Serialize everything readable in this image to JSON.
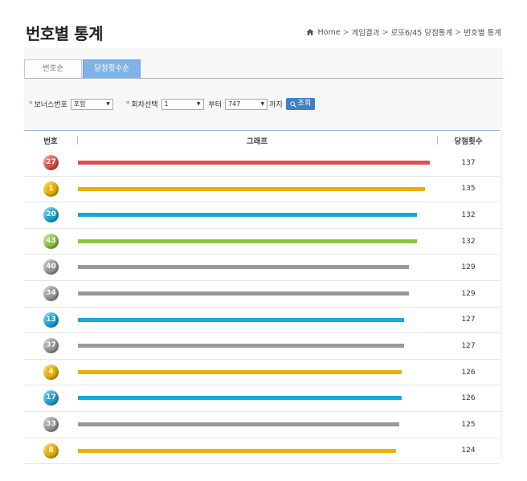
{
  "page": {
    "title": "번호별 통계",
    "breadcrumb": [
      "Home",
      "게임결과",
      "로또6/45 당첨통계",
      "번호별 통계"
    ],
    "breadcrumb_sep": ">"
  },
  "tabs": [
    {
      "label": "번호순",
      "active": false
    },
    {
      "label": "당첨횟수순",
      "active": true
    }
  ],
  "filters": {
    "bonus_label": "보너스번호",
    "bonus_value": "포함",
    "round_label": "회차선택",
    "round_from": "1",
    "from_label": "부터",
    "round_to": "747",
    "to_label": "까지",
    "search_button": "조회"
  },
  "table": {
    "headers": {
      "number": "번호",
      "graph": "그래프",
      "count": "당첨횟수"
    }
  },
  "colors": {
    "red": "#d9534f",
    "yellow": "#e8b300",
    "blue": "#1aa7d8",
    "green": "#8cc63f",
    "gray": "#999999"
  },
  "chart_data": {
    "type": "bar",
    "categories": [
      "27",
      "1",
      "20",
      "43",
      "40",
      "34",
      "13",
      "37",
      "4",
      "17",
      "33",
      "8"
    ],
    "values": [
      137,
      135,
      132,
      132,
      129,
      129,
      127,
      127,
      126,
      126,
      125,
      124
    ],
    "ball_colors": [
      "red",
      "yellow",
      "blue",
      "green",
      "gray",
      "gray",
      "blue",
      "gray",
      "yellow",
      "blue",
      "gray",
      "yellow"
    ],
    "ylabel": "당첨횟수"
  }
}
